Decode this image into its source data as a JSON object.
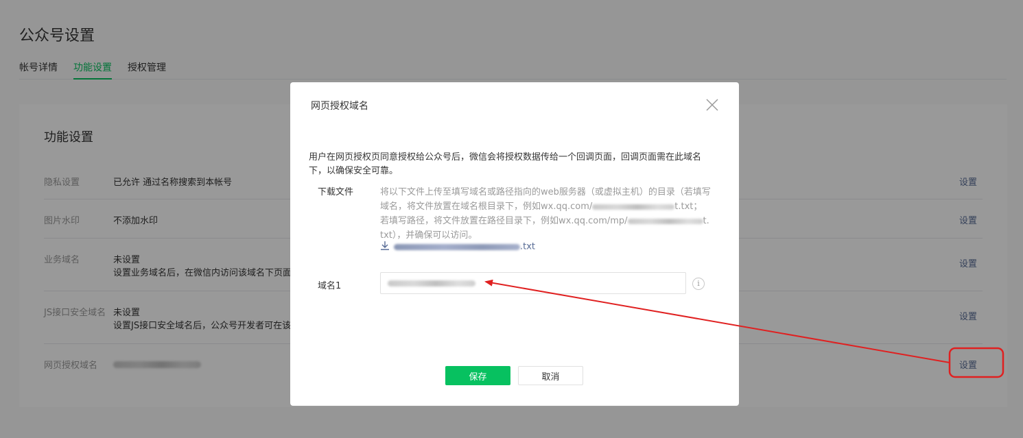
{
  "page": {
    "title": "公众号设置",
    "tabs": [
      {
        "label": "帐号详情",
        "active": false
      },
      {
        "label": "功能设置",
        "active": true
      },
      {
        "label": "授权管理",
        "active": false
      }
    ]
  },
  "card": {
    "title": "功能设置",
    "rows": [
      {
        "label": "隐私设置",
        "value": "已允许 通过名称搜索到本帐号",
        "action": "设置"
      },
      {
        "label": "图片水印",
        "value": "不添加水印",
        "action": "设置"
      },
      {
        "label": "业务域名",
        "value": "未设置",
        "detail": "设置业务域名后，在微信内访问该域名下页面时",
        "action": "设置"
      },
      {
        "label": "JS接口安全域名",
        "value": "未设置",
        "detail": "设置JS接口安全域名后，公众号开发者可在该域",
        "action": "设置"
      },
      {
        "label": "网页授权域名",
        "value": "",
        "action": "设置"
      }
    ]
  },
  "dialog": {
    "title": "网页授权域名",
    "description": "用户在网页授权页同意授权给公众号后，微信会将授权数据传给一个回调页面，回调页面需在此域名下，以确保安全可靠。",
    "download_label": "下载文件",
    "download_text_1": "将以下文件上传至填写域名或路径指向的web服务器（或虚拟主机）的目录（若填写域名，将文件放置在域名根目录下，例如wx.qq.com/",
    "download_text_2": "t.txt；若填写路径，将文件放置在路径目录下，例如wx.qq.com/mp/",
    "download_text_3": "t.txt），并确保可以访问。",
    "download_file_suffix": ".txt",
    "domain_label": "域名1",
    "info_icon": "i",
    "save_label": "保存",
    "cancel_label": "取消"
  },
  "colors": {
    "accent": "#07c160",
    "link": "#576b95",
    "annotation": "#e02020"
  },
  "icons": {
    "close": "close-icon",
    "download": "download-icon",
    "info": "info-icon"
  }
}
